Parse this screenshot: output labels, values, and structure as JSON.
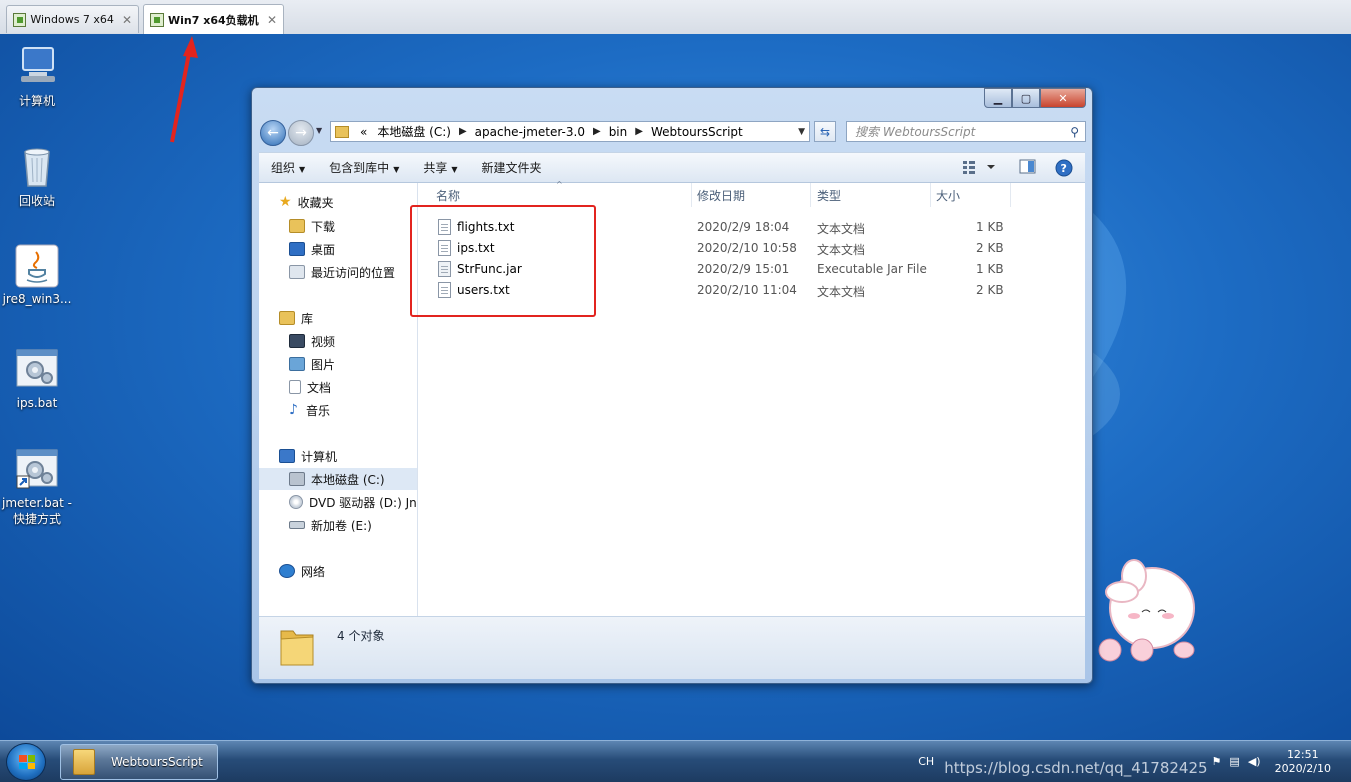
{
  "vm_tabs": [
    {
      "label": "Windows 7 x64",
      "close": "✕"
    },
    {
      "label": "Win7 x64负载机",
      "close": "✕"
    }
  ],
  "desktop_icons": [
    {
      "label": "计算机"
    },
    {
      "label": "回收站"
    },
    {
      "label": "jre8_win3..."
    },
    {
      "label": "ips.bat"
    },
    {
      "label": "jmeter.bat -",
      "label2": "快捷方式"
    }
  ],
  "window": {
    "controls": {
      "minimize": "▁",
      "maximize": "▢",
      "close": "✕"
    },
    "address": {
      "overflow": "«",
      "crumbs": [
        "本地磁盘 (C:)",
        "apache-jmeter-3.0",
        "bin",
        "WebtoursScript"
      ]
    },
    "search_placeholder": "搜索 WebtoursScript",
    "toolbar": {
      "organize": "组织",
      "include": "包含到库中",
      "share": "共享",
      "new_folder": "新建文件夹"
    },
    "nav": {
      "favorites": "收藏夹",
      "downloads": "下载",
      "desktop": "桌面",
      "recent": "最近访问的位置",
      "libraries": "库",
      "videos": "视频",
      "pictures": "图片",
      "documents": "文档",
      "music": "音乐",
      "computer": "计算机",
      "local_disk": "本地磁盘 (C:)",
      "dvd": "DVD 驱动器 (D:) Jn",
      "new_volume": "新加卷 (E:)",
      "network": "网络"
    },
    "columns": {
      "name": "名称",
      "modified": "修改日期",
      "type": "类型",
      "size": "大小"
    },
    "files": [
      {
        "name": "flights.txt",
        "modified": "2020/2/9 18:04",
        "type": "文本文档",
        "size": "1 KB"
      },
      {
        "name": "ips.txt",
        "modified": "2020/2/10 10:58",
        "type": "文本文档",
        "size": "2 KB"
      },
      {
        "name": "StrFunc.jar",
        "modified": "2020/2/9 15:01",
        "type": "Executable Jar File",
        "size": "1 KB"
      },
      {
        "name": "users.txt",
        "modified": "2020/2/10 11:04",
        "type": "文本文档",
        "size": "2 KB"
      }
    ],
    "status": "4 个对象"
  },
  "taskbar": {
    "task_label": "WebtoursScript",
    "ime": "CH",
    "time": "12:51",
    "date": "2020/2/10",
    "watermark": "https://blog.csdn.net/qq_41782425"
  }
}
